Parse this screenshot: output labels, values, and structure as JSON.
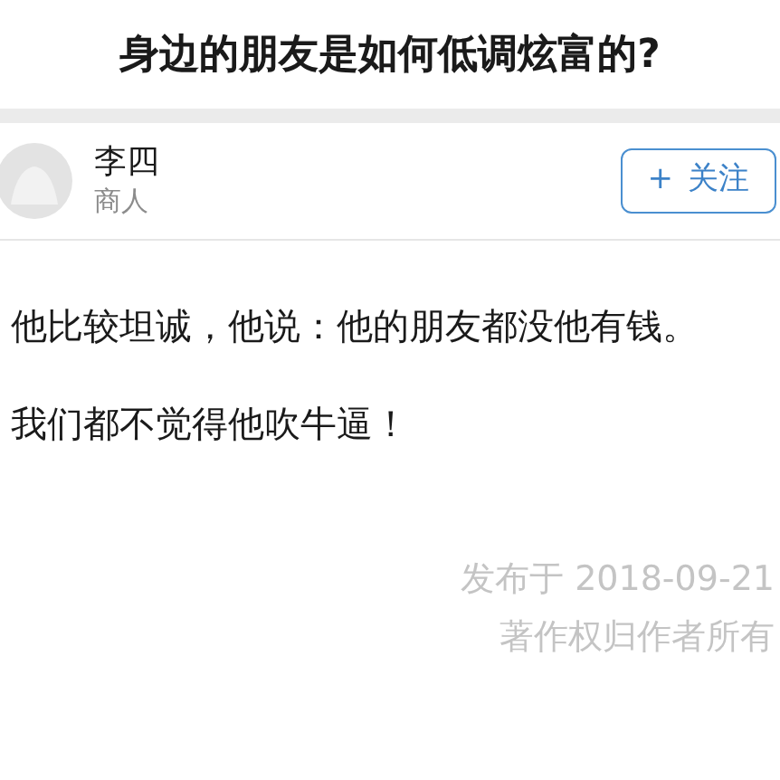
{
  "question": {
    "title": "身边的朋友是如何低调炫富的?"
  },
  "author": {
    "name": "李四",
    "headline": "商人",
    "follow_button": {
      "icon": "+",
      "label": "关注"
    }
  },
  "answer": {
    "paragraphs": [
      "他比较坦诚，他说：他的朋友都没他有钱。",
      "我们都不觉得他吹牛逼！"
    ],
    "published": "发布于 2018-09-21",
    "copyright": "著作权归作者所有"
  }
}
